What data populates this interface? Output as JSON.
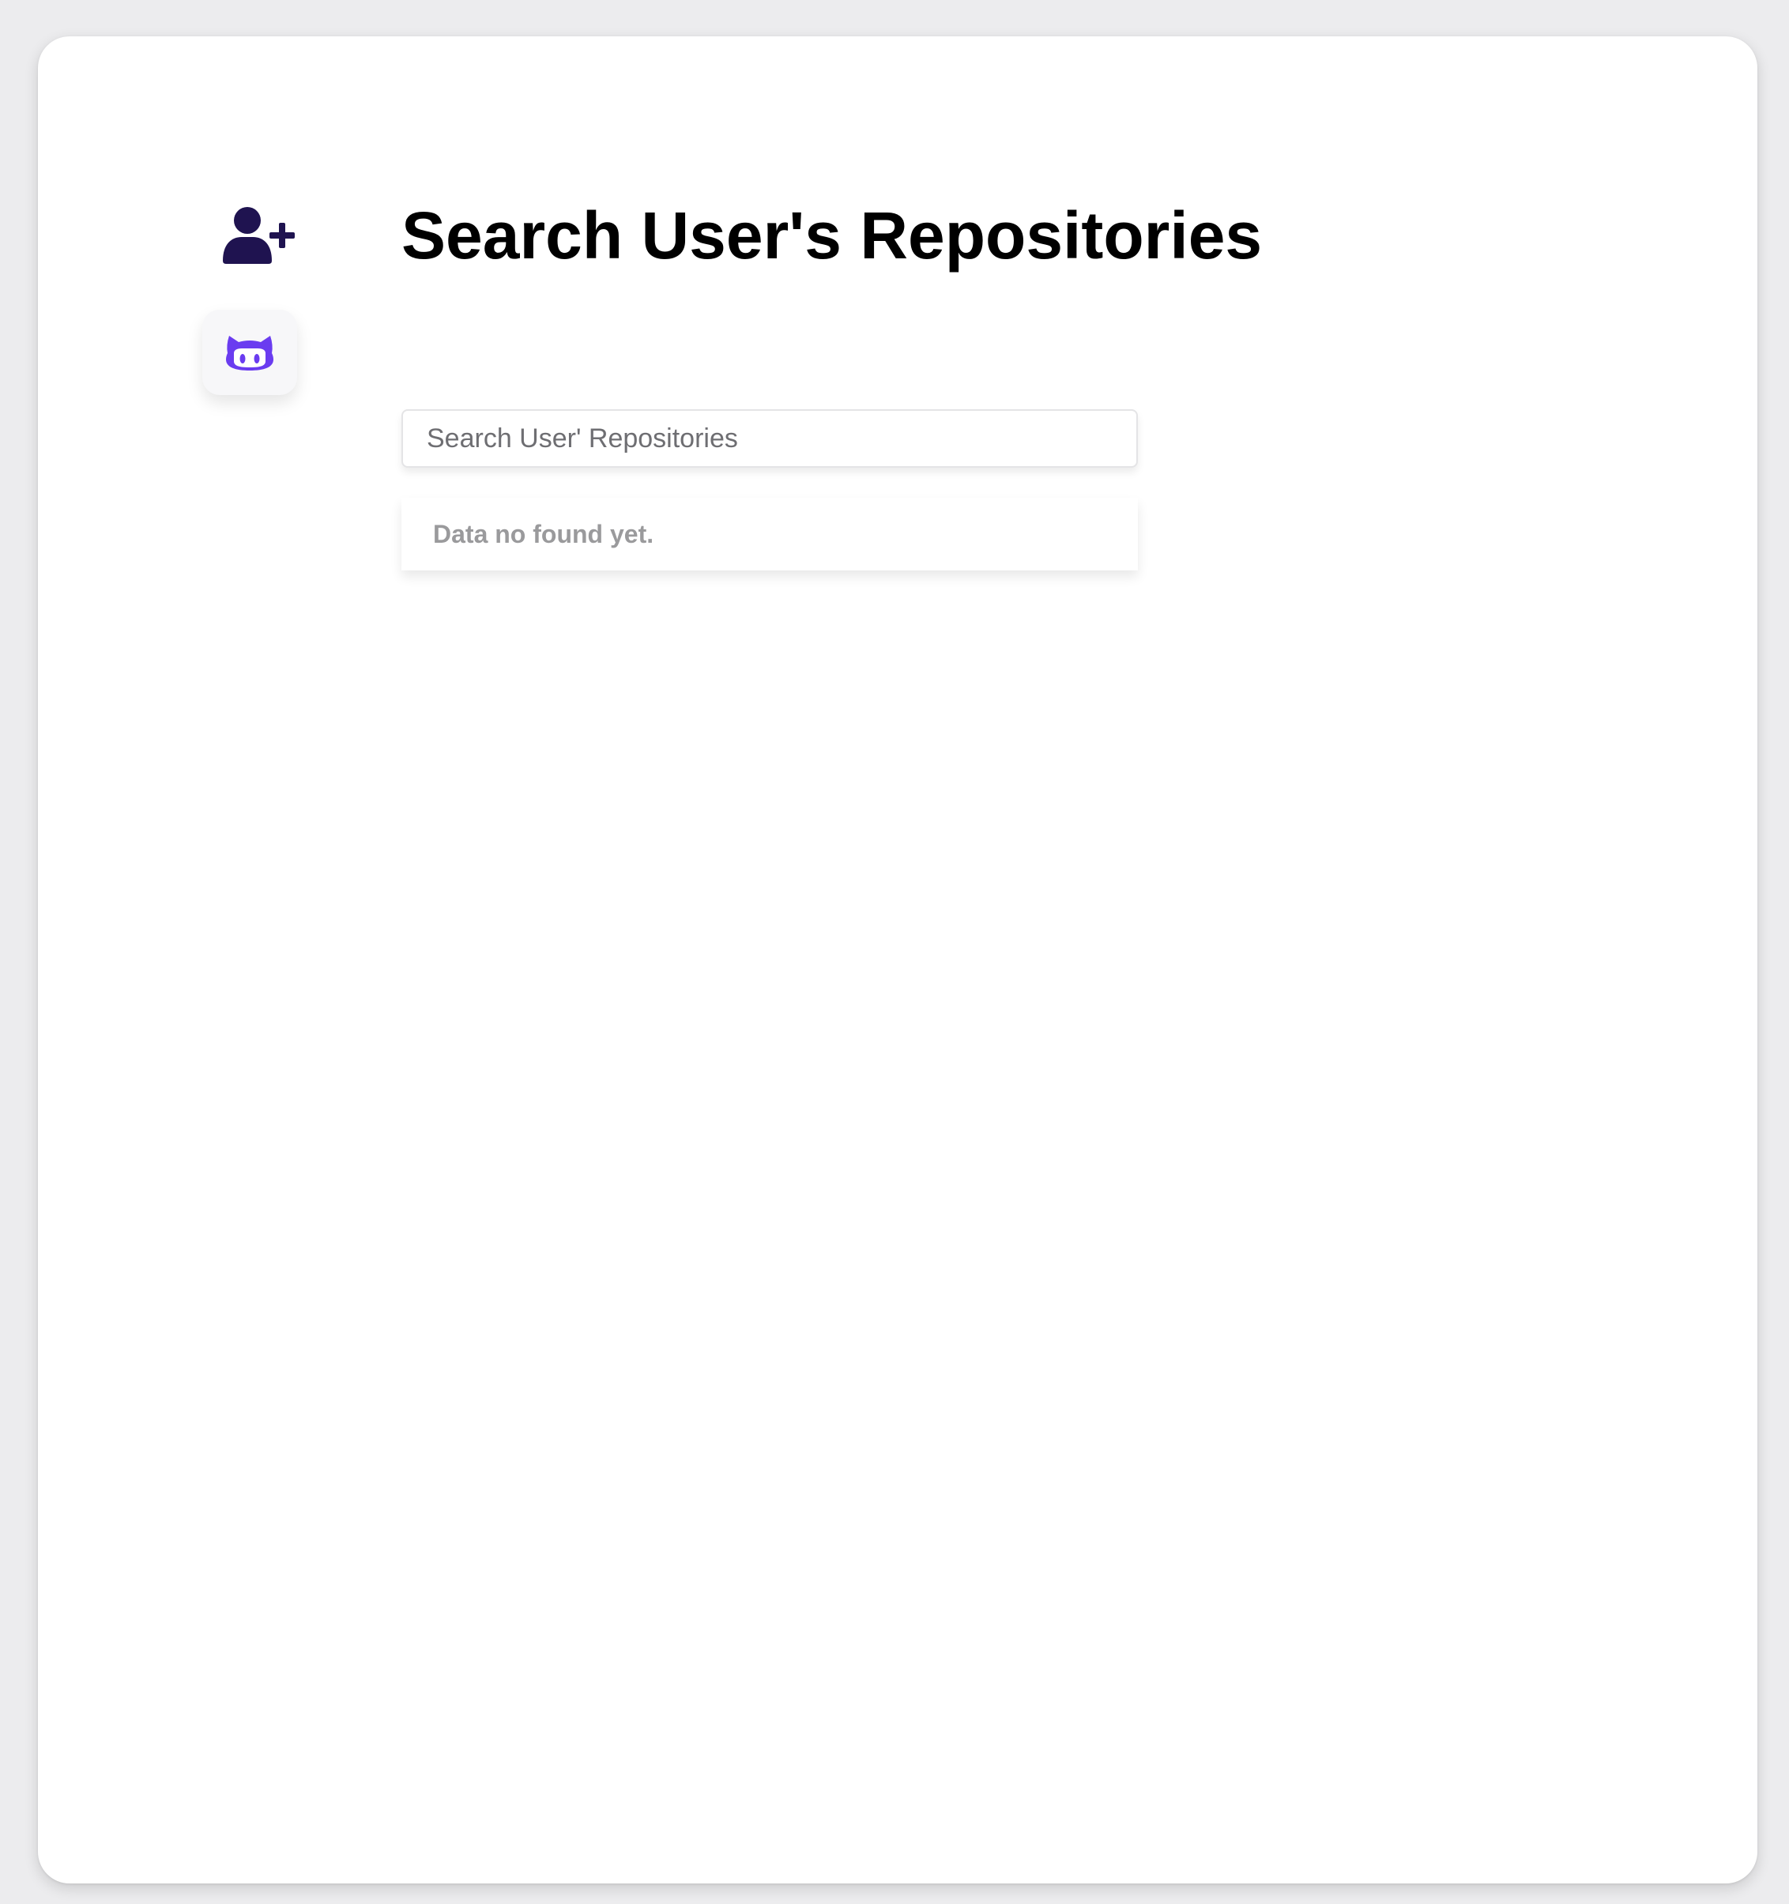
{
  "sidebar": {
    "add_user_icon": "user-plus-icon",
    "github_icon": "github-octocat-icon",
    "icon_color_dark": "#1f1350",
    "icon_color_accent": "#6a3cf0"
  },
  "main": {
    "title": "Search User's Repositories",
    "search": {
      "placeholder": "Search User' Repositories",
      "value": ""
    },
    "empty_message": "Data no found yet."
  }
}
